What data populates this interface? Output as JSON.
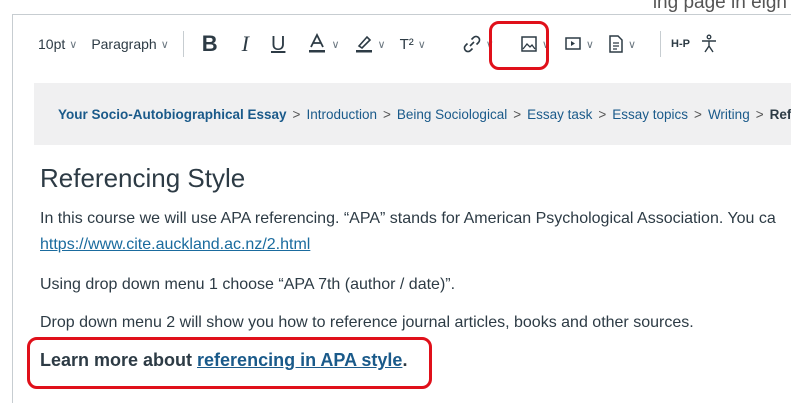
{
  "top_text": "ing page in eigh",
  "toolbar": {
    "font_size": "10pt",
    "block_format": "Paragraph",
    "bold_label": "B",
    "italic_label": "I",
    "underline_label": "U",
    "superscript_label": "T²",
    "h5p_label": "H-P",
    "icons": [
      "text-color-icon",
      "highlight-icon",
      "superscript-icon",
      "link-icon",
      "image-icon",
      "media-icon",
      "document-icon",
      "h5p-icon",
      "accessibility-icon"
    ]
  },
  "breadcrumb": {
    "items": [
      "Your Socio-Autobiographical Essay",
      "Introduction",
      "Being Sociological",
      "Essay task",
      "Essay topics",
      "Writing",
      "Refe"
    ],
    "separator": ">"
  },
  "content": {
    "heading": "Referencing Style",
    "para1": "In this course we will use APA referencing. “APA” stands for American Psychological Association. You ca",
    "para1_link": "https://www.cite.auckland.ac.nz/2.html",
    "para2": "Using drop down menu 1 choose “APA 7th (author / date)”.",
    "para3": "Drop down menu 2 will show you how to reference journal articles, books and other sources.",
    "learn_prefix": "Learn more about ",
    "learn_link": "referencing in APA style",
    "learn_suffix": "."
  },
  "colors": {
    "highlight": "#e0101a",
    "link": "#1a6b9e",
    "text": "#2d3b45",
    "band": "#f0f0f1"
  }
}
